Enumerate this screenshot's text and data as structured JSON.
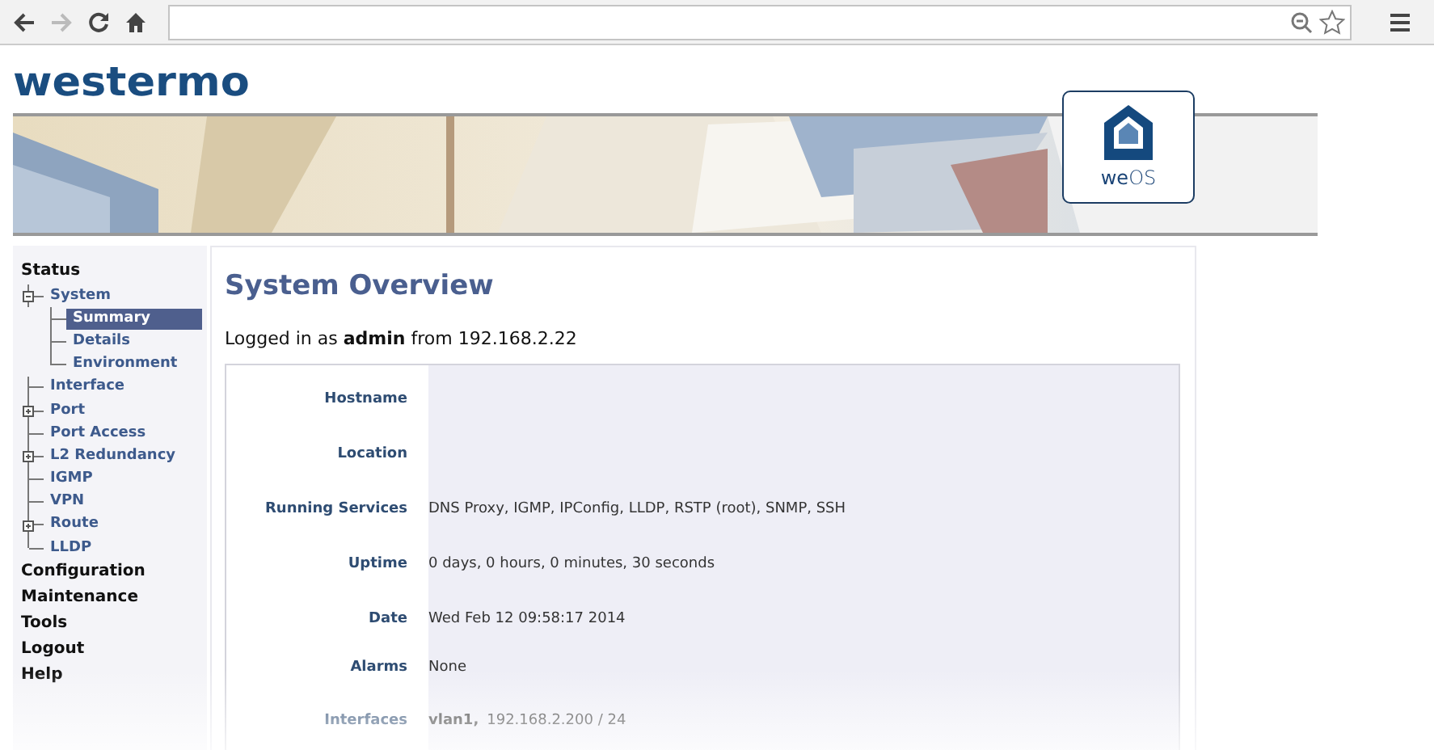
{
  "header": {
    "logo": "westermo",
    "badge": "**we**OS"
  },
  "sidebar": {
    "sections": [
      {
        "label": "Status",
        "children": [
          {
            "label": "System",
            "expanded": true,
            "selected": false,
            "children": [
              {
                "label": "Summary",
                "selected": true
              },
              {
                "label": "Details",
                "selected": false
              },
              {
                "label": "Environment",
                "selected": false
              }
            ]
          },
          {
            "label": "Interface",
            "selected": false
          },
          {
            "label": "Port",
            "expanded": false,
            "selected": false
          },
          {
            "label": "Port Access",
            "selected": false
          },
          {
            "label": "L2 Redundancy",
            "expanded": false,
            "selected": false
          },
          {
            "label": "IGMP",
            "selected": false
          },
          {
            "label": "VPN",
            "selected": false
          },
          {
            "label": "Route",
            "expanded": false,
            "selected": false
          },
          {
            "label": "LLDP",
            "selected": false
          }
        ]
      },
      {
        "label": "Configuration"
      },
      {
        "label": "Maintenance"
      },
      {
        "label": "Tools"
      },
      {
        "label": "Logout"
      },
      {
        "label": "Help"
      }
    ]
  },
  "content": {
    "title": "System Overview",
    "login_line": "Logged in as **admin** from 192.168.2.22",
    "rows": [
      {
        "label": "Hostname",
        "value": ""
      },
      {
        "label": "Location",
        "value": ""
      },
      {
        "label": "Running Services",
        "value": "DNS Proxy, IGMP, IPConfig, LLDP, RSTP (root), SNMP, SSH"
      },
      {
        "label": "Uptime",
        "value": "0 days, 0 hours, 0 minutes, 30 seconds"
      },
      {
        "label": "Date",
        "value": "Wed Feb 12 09:58:17 2014"
      },
      {
        "label": "Alarms",
        "value": "None"
      },
      {
        "label": "Interfaces",
        "name": "vlan1,",
        "value": "192.168.2.200 / 24"
      }
    ]
  }
}
